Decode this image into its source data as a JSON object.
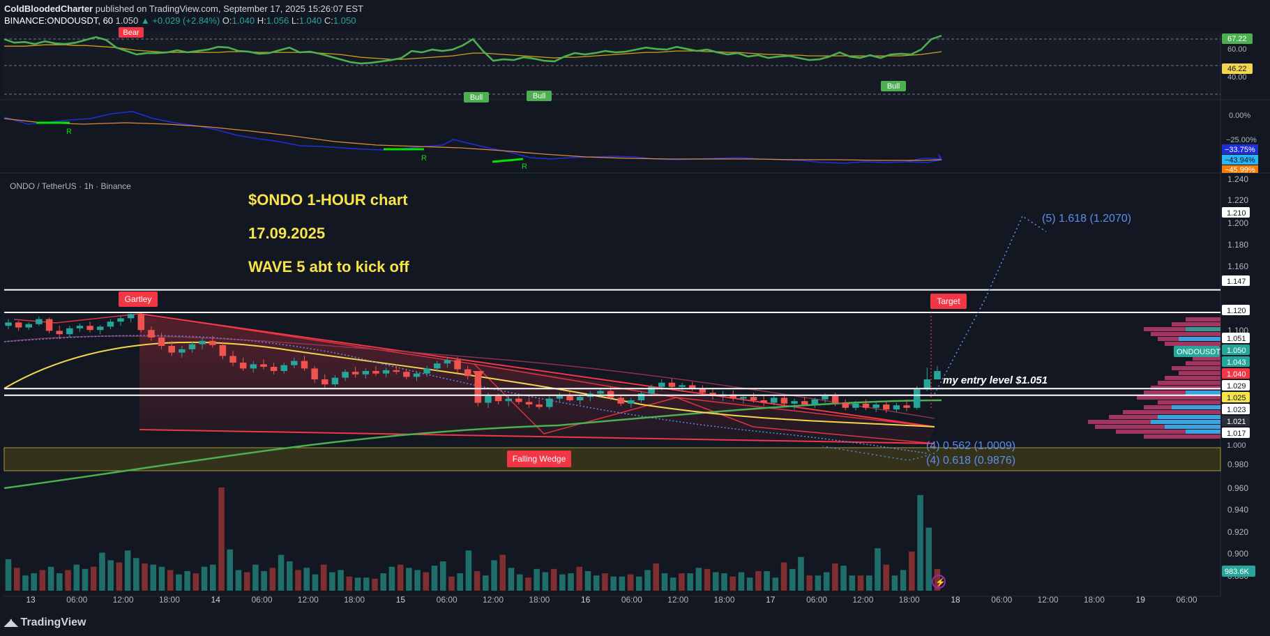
{
  "header": {
    "author": "ColdBloodedCharter",
    "published_text": "published on TradingView.com, September 17, 2025 15:26:07 EST",
    "symbol": "BINANCE:ONDOUSDT, 60",
    "last": "1.050",
    "change": "▲ +0.029 (+2.84%)",
    "o_label": "O:",
    "o_value": "1.040",
    "h_label": "H:",
    "h_value": "1.056",
    "l_label": "L:",
    "l_value": "1.040",
    "c_label": "C:",
    "c_value": "1.050"
  },
  "footer": {
    "logo_text": "TradingView",
    "logo_icon": "tradingview-logo-icon"
  },
  "colors": {
    "background": "#131722",
    "bull": "#26a69a",
    "bear": "#ef5350",
    "rsi": "#4caf50",
    "rsi_ma": "#d4a017",
    "fib": "#5b8def",
    "wedge": "#f23645",
    "level_line": "#ffffff",
    "annotation_text": "#f7e44a"
  },
  "chart_data": [
    {
      "type": "line",
      "panel": "rsi",
      "series": [
        {
          "values": [
            67,
            62,
            63,
            60,
            64,
            61,
            60,
            62,
            66,
            70,
            66,
            55,
            50,
            45,
            47,
            47,
            48,
            51,
            48,
            50,
            52,
            56,
            55,
            50,
            49,
            46,
            47,
            51,
            55,
            48,
            49,
            46,
            42,
            38,
            34,
            32,
            33,
            35,
            37,
            40,
            50,
            48,
            52,
            50,
            52,
            58,
            67,
            50,
            36,
            38,
            37,
            41,
            39,
            36,
            35,
            42,
            47,
            45,
            47,
            50,
            48,
            49,
            52,
            55,
            53,
            52,
            56,
            53,
            50,
            52,
            48,
            45,
            47,
            42,
            44,
            40,
            42,
            43,
            40,
            37,
            38,
            42,
            48,
            42,
            40,
            44,
            40,
            45,
            46,
            45,
            52,
            67,
            72
          ]
        },
        {
          "values": [
            57,
            57,
            57,
            58,
            59,
            59,
            59,
            58,
            58,
            57,
            56,
            55,
            53,
            51,
            50,
            49,
            48,
            48,
            48,
            48,
            48,
            48,
            49,
            49,
            49,
            48,
            48,
            48,
            48,
            48,
            48,
            47,
            46,
            45,
            43,
            41,
            40,
            39,
            38,
            38,
            39,
            40,
            41,
            42,
            43,
            45,
            47,
            47,
            46,
            45,
            44,
            43,
            42,
            41,
            40,
            41,
            41,
            42,
            43,
            44,
            45,
            46,
            47,
            48,
            48,
            49,
            50,
            50,
            50,
            49,
            49,
            48,
            48,
            47,
            46,
            45,
            45,
            44,
            44,
            43,
            43,
            43,
            43,
            43,
            43,
            43,
            43,
            43,
            43,
            44,
            45,
            47,
            49
          ]
        }
      ],
      "price_labels": [
        "67.22",
        "60.00",
        "46.22",
        "40.00"
      ],
      "signals": [
        "Bear",
        "Bull",
        "Bull",
        "Bull"
      ]
    },
    {
      "type": "line",
      "panel": "oscillator",
      "price_labels": [
        "0.00%",
        "−25.00%",
        "−33.75%",
        "−43.94%",
        "−45.99%"
      ],
      "divergence_labels": [
        "R",
        "R",
        "R"
      ]
    },
    {
      "type": "candlestick",
      "panel": "price",
      "legend": "ONDO / TetherUS · 1h · Binance",
      "title_lines": [
        "$ONDO    1-HOUR chart",
        "17.09.2025",
        "WAVE 5 abt to kick off"
      ],
      "ohlc": [
        [
          1.104,
          1.112,
          1.1,
          1.108
        ],
        [
          1.108,
          1.11,
          1.098,
          1.102
        ],
        [
          1.102,
          1.108,
          1.099,
          1.106
        ],
        [
          1.106,
          1.115,
          1.104,
          1.112
        ],
        [
          1.112,
          1.114,
          1.095,
          1.098
        ],
        [
          1.098,
          1.104,
          1.088,
          1.094
        ],
        [
          1.094,
          1.104,
          1.09,
          1.101
        ],
        [
          1.101,
          1.107,
          1.097,
          1.104
        ],
        [
          1.104,
          1.109,
          1.096,
          1.099
        ],
        [
          1.099,
          1.105,
          1.094,
          1.103
        ],
        [
          1.103,
          1.112,
          1.1,
          1.109
        ],
        [
          1.109,
          1.116,
          1.104,
          1.113
        ],
        [
          1.113,
          1.121,
          1.108,
          1.118
        ],
        [
          1.118,
          1.121,
          1.096,
          1.099
        ],
        [
          1.099,
          1.103,
          1.086,
          1.09
        ],
        [
          1.09,
          1.096,
          1.076,
          1.08
        ],
        [
          1.08,
          1.086,
          1.068,
          1.072
        ],
        [
          1.072,
          1.08,
          1.066,
          1.076
        ],
        [
          1.076,
          1.085,
          1.072,
          1.082
        ],
        [
          1.082,
          1.09,
          1.076,
          1.086
        ],
        [
          1.086,
          1.092,
          1.078,
          1.081
        ],
        [
          1.081,
          1.085,
          1.064,
          1.068
        ],
        [
          1.068,
          1.074,
          1.056,
          1.06
        ],
        [
          1.06,
          1.066,
          1.05,
          1.053
        ],
        [
          1.053,
          1.062,
          1.048,
          1.058
        ],
        [
          1.058,
          1.064,
          1.052,
          1.055
        ],
        [
          1.055,
          1.06,
          1.046,
          1.05
        ],
        [
          1.05,
          1.06,
          1.047,
          1.057
        ],
        [
          1.057,
          1.066,
          1.053,
          1.062
        ],
        [
          1.062,
          1.068,
          1.05,
          1.053
        ],
        [
          1.053,
          1.056,
          1.036,
          1.04
        ],
        [
          1.04,
          1.046,
          1.03,
          1.034
        ],
        [
          1.034,
          1.045,
          1.031,
          1.042
        ],
        [
          1.042,
          1.052,
          1.038,
          1.049
        ],
        [
          1.049,
          1.055,
          1.042,
          1.046
        ],
        [
          1.046,
          1.053,
          1.041,
          1.05
        ],
        [
          1.05,
          1.056,
          1.044,
          1.047
        ],
        [
          1.047,
          1.054,
          1.042,
          1.051
        ],
        [
          1.051,
          1.058,
          1.046,
          1.049
        ],
        [
          1.049,
          1.052,
          1.04,
          1.043
        ],
        [
          1.043,
          1.05,
          1.038,
          1.047
        ],
        [
          1.047,
          1.056,
          1.043,
          1.053
        ],
        [
          1.053,
          1.062,
          1.049,
          1.059
        ],
        [
          1.059,
          1.066,
          1.054,
          1.063
        ],
        [
          1.063,
          1.067,
          1.048,
          1.052
        ],
        [
          1.052,
          1.056,
          1.04,
          1.044
        ],
        [
          1.044,
          1.048,
          1.008,
          1.012
        ],
        [
          1.012,
          1.024,
          1.006,
          1.02
        ],
        [
          1.02,
          1.023,
          1.01,
          1.014
        ],
        [
          1.014,
          1.02,
          1.008,
          1.017
        ],
        [
          1.017,
          1.022,
          1.01,
          1.013
        ],
        [
          1.013,
          1.018,
          1.006,
          1.01
        ],
        [
          1.01,
          1.016,
          1.004,
          1.007
        ],
        [
          1.007,
          1.02,
          1.004,
          1.017
        ],
        [
          1.017,
          1.024,
          1.012,
          1.02
        ],
        [
          1.02,
          1.025,
          1.013,
          1.015
        ],
        [
          1.015,
          1.022,
          1.01,
          1.019
        ],
        [
          1.019,
          1.026,
          1.014,
          1.023
        ],
        [
          1.023,
          1.03,
          1.018,
          1.026
        ],
        [
          1.026,
          1.031,
          1.015,
          1.018
        ],
        [
          1.018,
          1.022,
          1.008,
          1.011
        ],
        [
          1.011,
          1.018,
          1.006,
          1.015
        ],
        [
          1.015,
          1.026,
          1.012,
          1.023
        ],
        [
          1.023,
          1.034,
          1.02,
          1.031
        ],
        [
          1.031,
          1.04,
          1.027,
          1.036
        ],
        [
          1.036,
          1.041,
          1.028,
          1.031
        ],
        [
          1.031,
          1.036,
          1.025,
          1.033
        ],
        [
          1.033,
          1.037,
          1.026,
          1.029
        ],
        [
          1.029,
          1.033,
          1.021,
          1.024
        ],
        [
          1.024,
          1.029,
          1.016,
          1.02
        ],
        [
          1.02,
          1.026,
          1.014,
          1.022
        ],
        [
          1.022,
          1.027,
          1.014,
          1.017
        ],
        [
          1.017,
          1.022,
          1.011,
          1.019
        ],
        [
          1.019,
          1.024,
          1.012,
          1.015
        ],
        [
          1.015,
          1.02,
          1.008,
          1.012
        ],
        [
          1.012,
          1.021,
          1.009,
          1.018
        ],
        [
          1.018,
          1.022,
          1.008,
          1.011
        ],
        [
          1.011,
          1.017,
          1.004,
          1.014
        ],
        [
          1.014,
          1.019,
          1.008,
          1.01
        ],
        [
          1.01,
          1.018,
          1.006,
          1.016
        ],
        [
          1.016,
          1.023,
          1.012,
          1.02
        ],
        [
          1.02,
          1.024,
          1.008,
          1.012
        ],
        [
          1.012,
          1.016,
          1.003,
          1.006
        ],
        [
          1.006,
          1.014,
          1.003,
          1.011
        ],
        [
          1.011,
          1.016,
          1.003,
          1.006
        ],
        [
          1.006,
          1.013,
          1.001,
          1.01
        ],
        [
          1.01,
          1.014,
          1.0,
          1.004
        ],
        [
          1.004,
          1.012,
          1.001,
          1.009
        ],
        [
          1.009,
          1.016,
          1.002,
          1.006
        ],
        [
          1.006,
          1.032,
          1.004,
          1.028
        ],
        [
          1.028,
          1.054,
          1.026,
          1.04
        ],
        [
          1.04,
          1.056,
          1.04,
          1.05
        ]
      ],
      "volume": [
        29,
        21,
        14,
        16,
        19,
        22,
        16,
        19,
        24,
        20,
        22,
        35,
        28,
        26,
        37,
        30,
        25,
        24,
        22,
        19,
        15,
        18,
        16,
        22,
        24,
        95,
        38,
        19,
        17,
        24,
        18,
        21,
        33,
        27,
        19,
        21,
        15,
        24,
        17,
        19,
        13,
        12,
        12,
        11,
        16,
        22,
        24,
        21,
        19,
        17,
        23,
        27,
        13,
        16,
        37,
        18,
        14,
        28,
        33,
        21,
        15,
        12,
        20,
        17,
        20,
        15,
        16,
        22,
        18,
        14,
        16,
        13,
        13,
        15,
        13,
        19,
        25,
        16,
        12,
        16,
        16,
        21,
        20,
        17,
        16,
        13,
        17,
        12,
        18,
        18,
        12,
        26,
        20,
        31,
        14,
        14,
        17,
        25,
        23,
        14,
        14,
        14,
        39,
        24,
        14,
        19,
        36,
        88,
        58,
        20
      ],
      "volume_label": "983.6K",
      "ylim": [
        0.98,
        1.24
      ],
      "y_ticks": [
        "1.240",
        "1.220",
        "1.200",
        "1.180",
        "1.160",
        "1.100",
        "0.980",
        "0.960",
        "0.940",
        "0.920",
        "0.900",
        "0.880"
      ],
      "x_ticks": [
        "13",
        "06:00",
        "12:00",
        "18:00",
        "14",
        "06:00",
        "12:00",
        "18:00",
        "15",
        "06:00",
        "12:00",
        "18:00",
        "16",
        "06:00",
        "12:00",
        "18:00",
        "17",
        "06:00",
        "12:00",
        "18:00",
        "18",
        "06:00",
        "12:00",
        "18:00",
        "19",
        "06:00"
      ],
      "horizontal_levels": [
        1.147,
        1.12,
        1.029,
        1.021
      ],
      "price_labels": [
        {
          "text": "1.210",
          "style": "white"
        },
        {
          "text": "1.147",
          "style": "white"
        },
        {
          "text": "1.120",
          "style": "white"
        },
        {
          "text": "1.051",
          "style": "white"
        },
        {
          "text": "1.050",
          "style": "green"
        },
        {
          "text": "1.043",
          "style": "green"
        },
        {
          "text": "1.040",
          "style": "red"
        },
        {
          "text": "1.029",
          "style": "white"
        },
        {
          "text": "1.025",
          "style": "yellow"
        },
        {
          "text": "1.023",
          "style": "white"
        },
        {
          "text": "1.021",
          "style": "dark"
        },
        {
          "text": "1.017",
          "style": "white"
        },
        {
          "text": "1.000",
          "style": "plain"
        }
      ],
      "symbol_tag": "ONDOUSDT",
      "annotations": {
        "pattern_top": "Gartley",
        "pattern_bottom": "Falling Wedge",
        "target_label": "Target",
        "entry_text": "my entry level $1.051",
        "fib_wave5": "(5) 1.618 (1.2070)",
        "fib_0562": "(4) 0.562 (1.0009)",
        "fib_0618": "(4) 0.618 (0.9876)"
      }
    }
  ]
}
